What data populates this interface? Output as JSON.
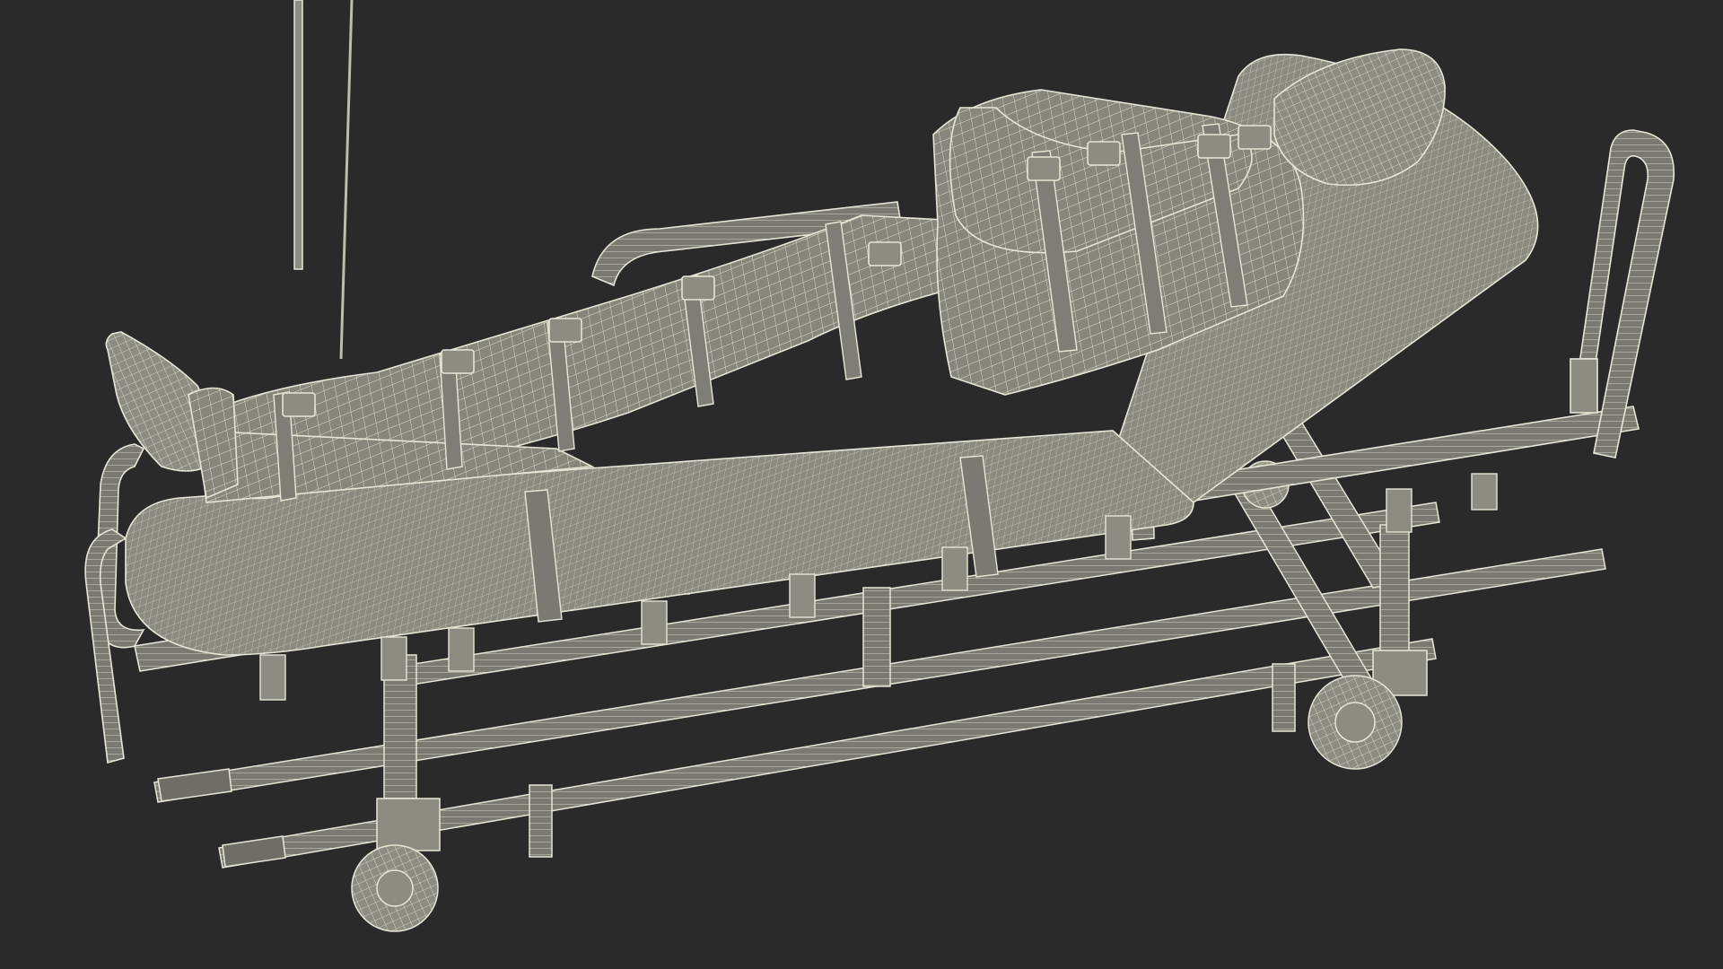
{
  "scene": {
    "subject": "wireframe-render",
    "colors": {
      "background": "#2a2a2a",
      "mesh_fill": "#8c8c82",
      "mesh_fill_dark": "#6e6e66",
      "wire": "#e6e6d6",
      "wire_dim": "#bdbdae",
      "shadow": "#1f1f1f"
    }
  }
}
